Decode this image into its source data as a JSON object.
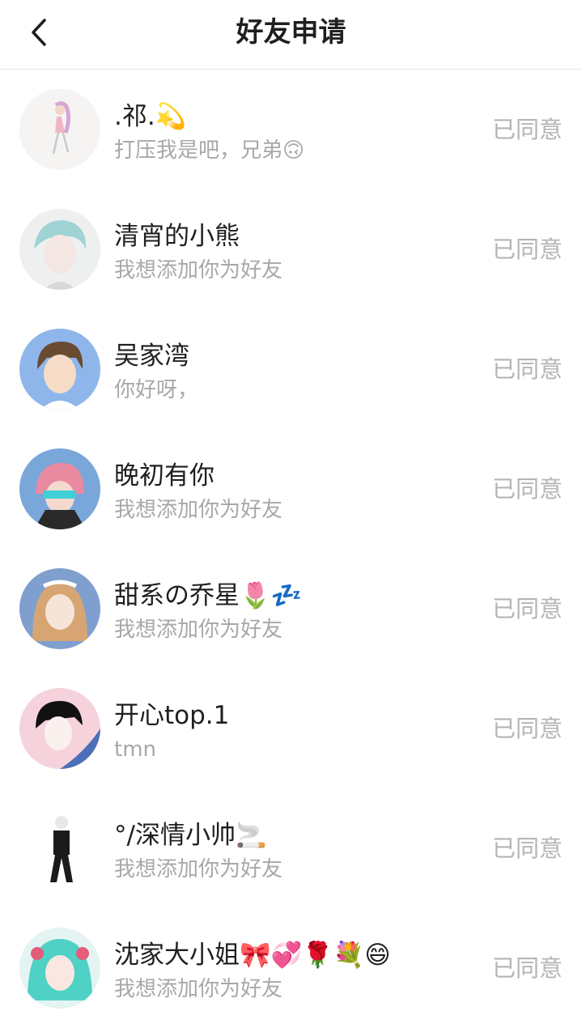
{
  "header": {
    "title": "好友申请"
  },
  "requests": [
    {
      "name": ".祁.💫",
      "message": "打压我是吧，兄弟🙃",
      "status": "已同意"
    },
    {
      "name": "清宵的小熊",
      "message": "我想添加你为好友",
      "status": "已同意"
    },
    {
      "name": "吴家湾",
      "message": "你好呀，",
      "status": "已同意"
    },
    {
      "name": "晚初有你",
      "message": "我想添加你为好友",
      "status": "已同意"
    },
    {
      "name": "甜系の乔星🌷💤",
      "message": "我想添加你为好友",
      "status": "已同意"
    },
    {
      "name": "开心top.1",
      "message": "tmn",
      "status": "已同意"
    },
    {
      "name": "°/深情小帅🚬",
      "message": "我想添加你为好友",
      "status": "已同意"
    },
    {
      "name": "沈家大小姐🎀💞🌹💐😄",
      "message": "我想添加你为好友",
      "status": "已同意"
    }
  ]
}
